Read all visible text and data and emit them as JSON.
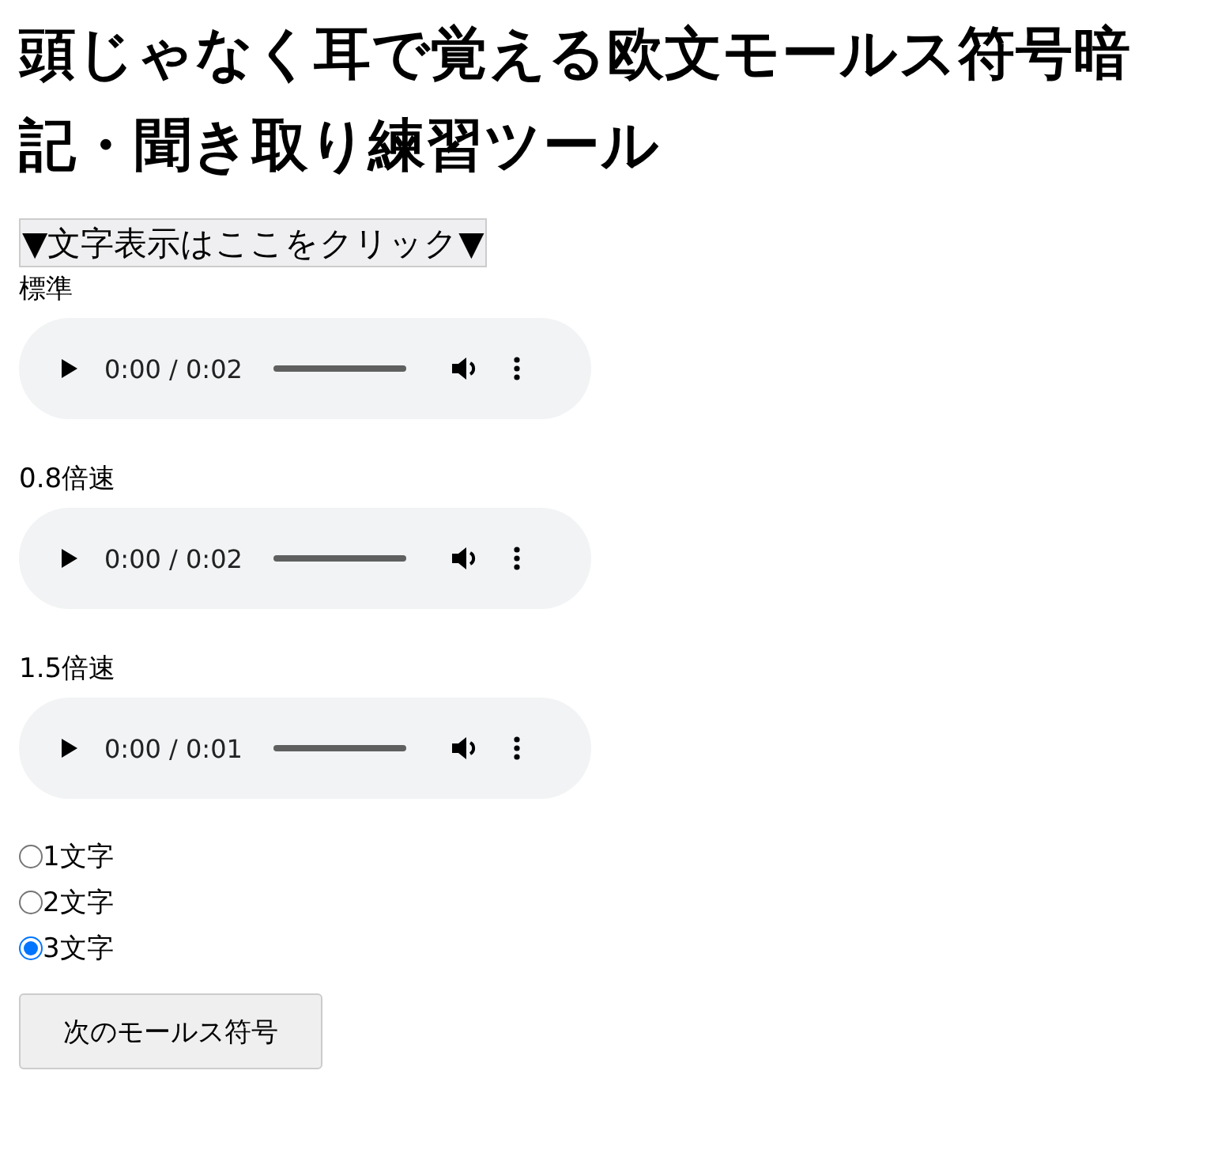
{
  "title": "頭じゃなく耳で覚える欧文モールス符号暗記・聞き取り練習ツール",
  "toggle": "▼文字表示はここをクリック▼",
  "players": [
    {
      "label": "標準",
      "time": "0:00 / 0:02"
    },
    {
      "label": "0.8倍速",
      "time": "0:00 / 0:02"
    },
    {
      "label": "1.5倍速",
      "time": "0:00 / 0:01"
    }
  ],
  "options": [
    {
      "label": "1文字",
      "selected": false
    },
    {
      "label": "2文字",
      "selected": false
    },
    {
      "label": "3文字",
      "selected": true
    }
  ],
  "next_button": "次のモールス符号"
}
